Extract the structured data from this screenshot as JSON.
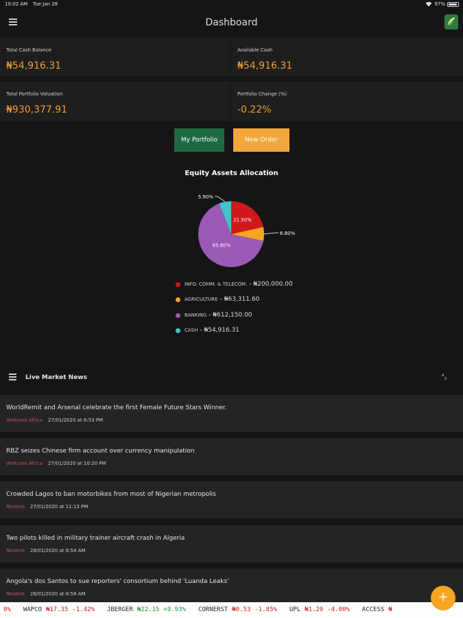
{
  "status_bar": {
    "time": "10:02 AM",
    "date": "Tue Jan 28",
    "battery": "97%"
  },
  "header": {
    "title": "Dashboard"
  },
  "summary": {
    "total_cash_balance": {
      "label": "Total Cash Balance",
      "value": "₦54,916.31"
    },
    "available_cash": {
      "label": "Available Cash",
      "value": "₦54,916.31"
    },
    "total_portfolio_valuation": {
      "label": "Total Portfolio Valuation",
      "value": "₦930,377.91"
    },
    "portfolio_change": {
      "label": "Portfolio Change (%)",
      "value": "-0.22%"
    }
  },
  "buttons": {
    "my_portfolio": "My Portfolio",
    "new_order": "New Order"
  },
  "chart_data": {
    "type": "pie",
    "title": "Equity Assets Allocation",
    "slices": [
      {
        "name": "INFO. COMM. & TELECOM.",
        "amount": "₦200,000.00",
        "percent": 21.5,
        "label": "21.50%",
        "color": "#d0191d"
      },
      {
        "name": "AGRICULTURE",
        "amount": "₦63,311.60",
        "percent": 6.8,
        "label": "6.80%",
        "color": "#f5a623"
      },
      {
        "name": "BANKING",
        "amount": "₦612,150.00",
        "percent": 65.8,
        "label": "65.80%",
        "color": "#9b59b6"
      },
      {
        "name": "CASH",
        "amount": "₦54,916.31",
        "percent": 5.9,
        "label": "5.90%",
        "color": "#3cc7c9"
      }
    ]
  },
  "news": {
    "title": "Live Market News",
    "items": [
      {
        "headline": "WorldRemit and Arsenal celebrate the first Female Future Stars Winner.",
        "source": "Ventures Africa",
        "timestamp": "27/01/2020 at 6:53 PM"
      },
      {
        "headline": "RBZ seizes Chinese firm account over currency manipulation",
        "source": "Ventures Africa",
        "timestamp": "27/01/2020 at 10:20 PM"
      },
      {
        "headline": "Crowded Lagos to ban motorbikes from most of Nigerian metropolis",
        "source": "Reuters",
        "timestamp": "27/01/2020 at 11:13 PM"
      },
      {
        "headline": "Two pilots killed in military trainer aircraft crash in Algeria",
        "source": "Reuters",
        "timestamp": "28/01/2020 at 8:54 AM"
      },
      {
        "headline": "Angola's dos Santos to sue reporters' consortium behind 'Luanda Leaks'",
        "source": "Reuters",
        "timestamp": "28/01/2020 at 8:58 AM"
      }
    ]
  },
  "ticker": {
    "lead_fragment": "0%",
    "items": [
      {
        "symbol": "WAPCO",
        "price": "₦17.35",
        "change": "-1.42%",
        "direction": "down"
      },
      {
        "symbol": "JBERGER",
        "price": "₦22.15",
        "change": "+9.93%",
        "direction": "up"
      },
      {
        "symbol": "CORNERST",
        "price": "₦0.53",
        "change": "-1.85%",
        "direction": "down"
      },
      {
        "symbol": "UPL",
        "price": "₦1.20",
        "change": "-4.00%",
        "direction": "down"
      },
      {
        "symbol": "ACCESS",
        "price": "₦",
        "change": "",
        "direction": "down"
      }
    ],
    "colors": {
      "up": "#1e8f3c",
      "down": "#d0191d"
    }
  },
  "fab": {
    "label": "+"
  },
  "icons": {
    "menu": "hamburger-icon",
    "logo": "leaf-logo-icon",
    "news_list": "list-icon",
    "sort": "sort-az-icon",
    "wifi": "wifi-icon",
    "battery": "battery-icon"
  }
}
